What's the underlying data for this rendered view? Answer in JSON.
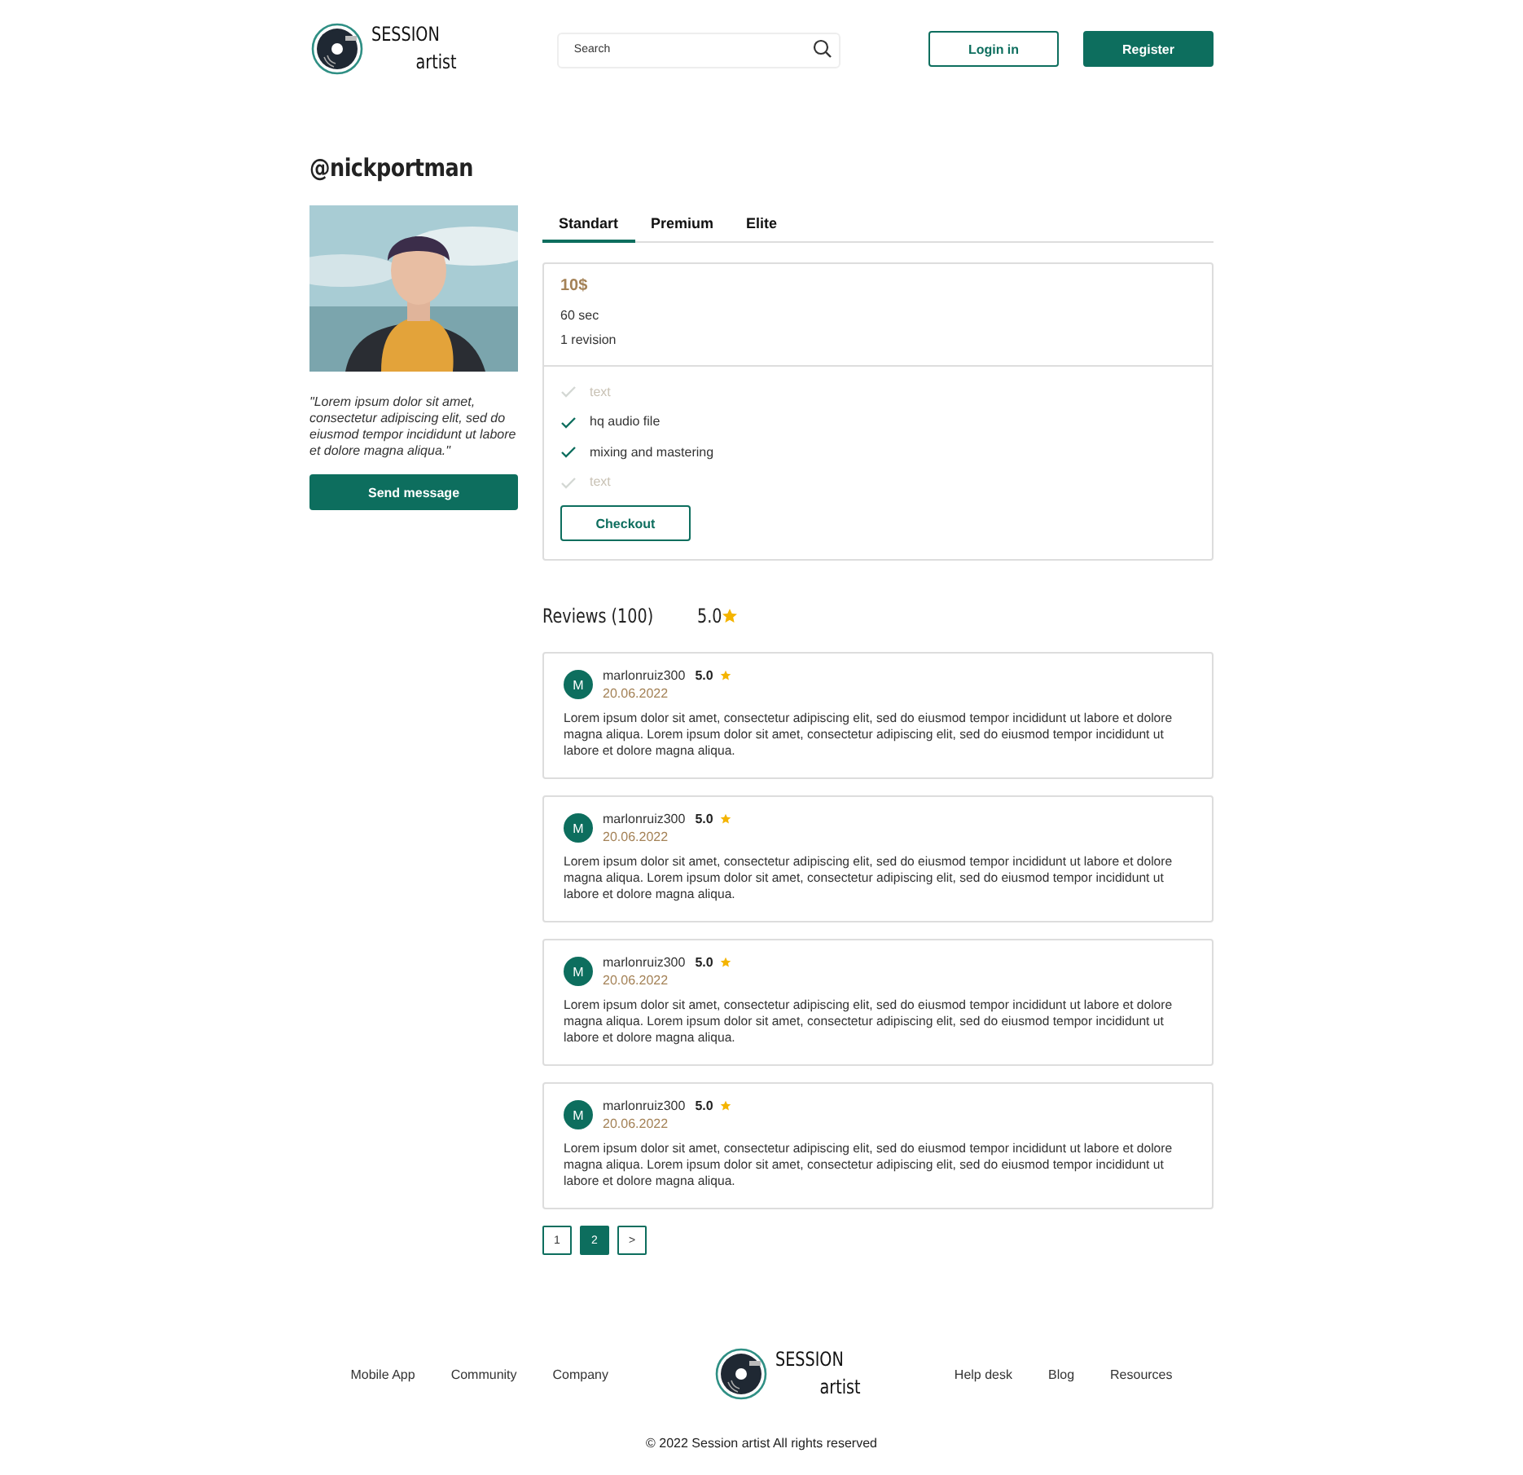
{
  "header": {
    "logo": {
      "line1": "SESSION",
      "line2": "artist"
    },
    "search": {
      "placeholder": "Search"
    },
    "buttons": [
      {
        "label": "Login in",
        "kind": "outline"
      },
      {
        "label": "Register",
        "kind": "filled"
      }
    ]
  },
  "profile": {
    "username": "@nickportman",
    "quote": "\"Lorem ipsum dolor sit amet, consectetur adipiscing elit, sed do eiusmod tempor incididunt ut labore et dolore magna aliqua.\"",
    "button": "Send message"
  },
  "tabs": [
    {
      "label": "Standart",
      "selected": true
    },
    {
      "label": "Premium",
      "selected": false
    },
    {
      "label": "Elite",
      "selected": false
    }
  ],
  "package": {
    "price": "10$",
    "details": [
      "60 sec",
      "1 revision"
    ],
    "features": [
      {
        "label": "text",
        "included": false
      },
      {
        "label": "hq audio file",
        "included": true
      },
      {
        "label": "mixing and mastering",
        "included": true
      },
      {
        "label": "text",
        "included": false
      }
    ],
    "button": "Checkout"
  },
  "reviews": {
    "title": "Reviews (100)",
    "rating": "5.0",
    "items": [
      {
        "initial": "M",
        "user": "marlonruiz300",
        "rating": "5.0",
        "date": "20.06.2022",
        "text": "Lorem ipsum dolor sit amet, consectetur adipiscing elit, sed do eiusmod tempor incididunt ut labore et dolore magna aliqua. Lorem ipsum dolor sit amet, consectetur adipiscing elit, sed do eiusmod tempor incididunt ut labore et dolore magna aliqua."
      },
      {
        "initial": "M",
        "user": "marlonruiz300",
        "rating": "5.0",
        "date": "20.06.2022",
        "text": "Lorem ipsum dolor sit amet, consectetur adipiscing elit, sed do eiusmod tempor incididunt ut labore et dolore magna aliqua. Lorem ipsum dolor sit amet, consectetur adipiscing elit, sed do eiusmod tempor incididunt ut labore et dolore magna aliqua."
      },
      {
        "initial": "M",
        "user": "marlonruiz300",
        "rating": "5.0",
        "date": "20.06.2022",
        "text": "Lorem ipsum dolor sit amet, consectetur adipiscing elit, sed do eiusmod tempor incididunt ut labore et dolore magna aliqua. Lorem ipsum dolor sit amet, consectetur adipiscing elit, sed do eiusmod tempor incididunt ut labore et dolore magna aliqua."
      },
      {
        "initial": "M",
        "user": "marlonruiz300",
        "rating": "5.0",
        "date": "20.06.2022",
        "text": "Lorem ipsum dolor sit amet, consectetur adipiscing elit, sed do eiusmod tempor incididunt ut labore et dolore magna aliqua. Lorem ipsum dolor sit amet, consectetur adipiscing elit, sed do eiusmod tempor incididunt ut labore et dolore magna aliqua."
      }
    ]
  },
  "pagination": [
    {
      "label": "1",
      "selected": false
    },
    {
      "label": "2",
      "selected": true
    },
    {
      "label": ">",
      "selected": false
    }
  ],
  "footer": {
    "links_left": [
      "Mobile App",
      "Community",
      "Company"
    ],
    "logo": {
      "line1": "SESSION",
      "line2": "artist"
    },
    "links_right": [
      "Help desk",
      "Blog",
      "Resources"
    ],
    "copyright": "© 2022 Session artist All rights reserved"
  }
}
